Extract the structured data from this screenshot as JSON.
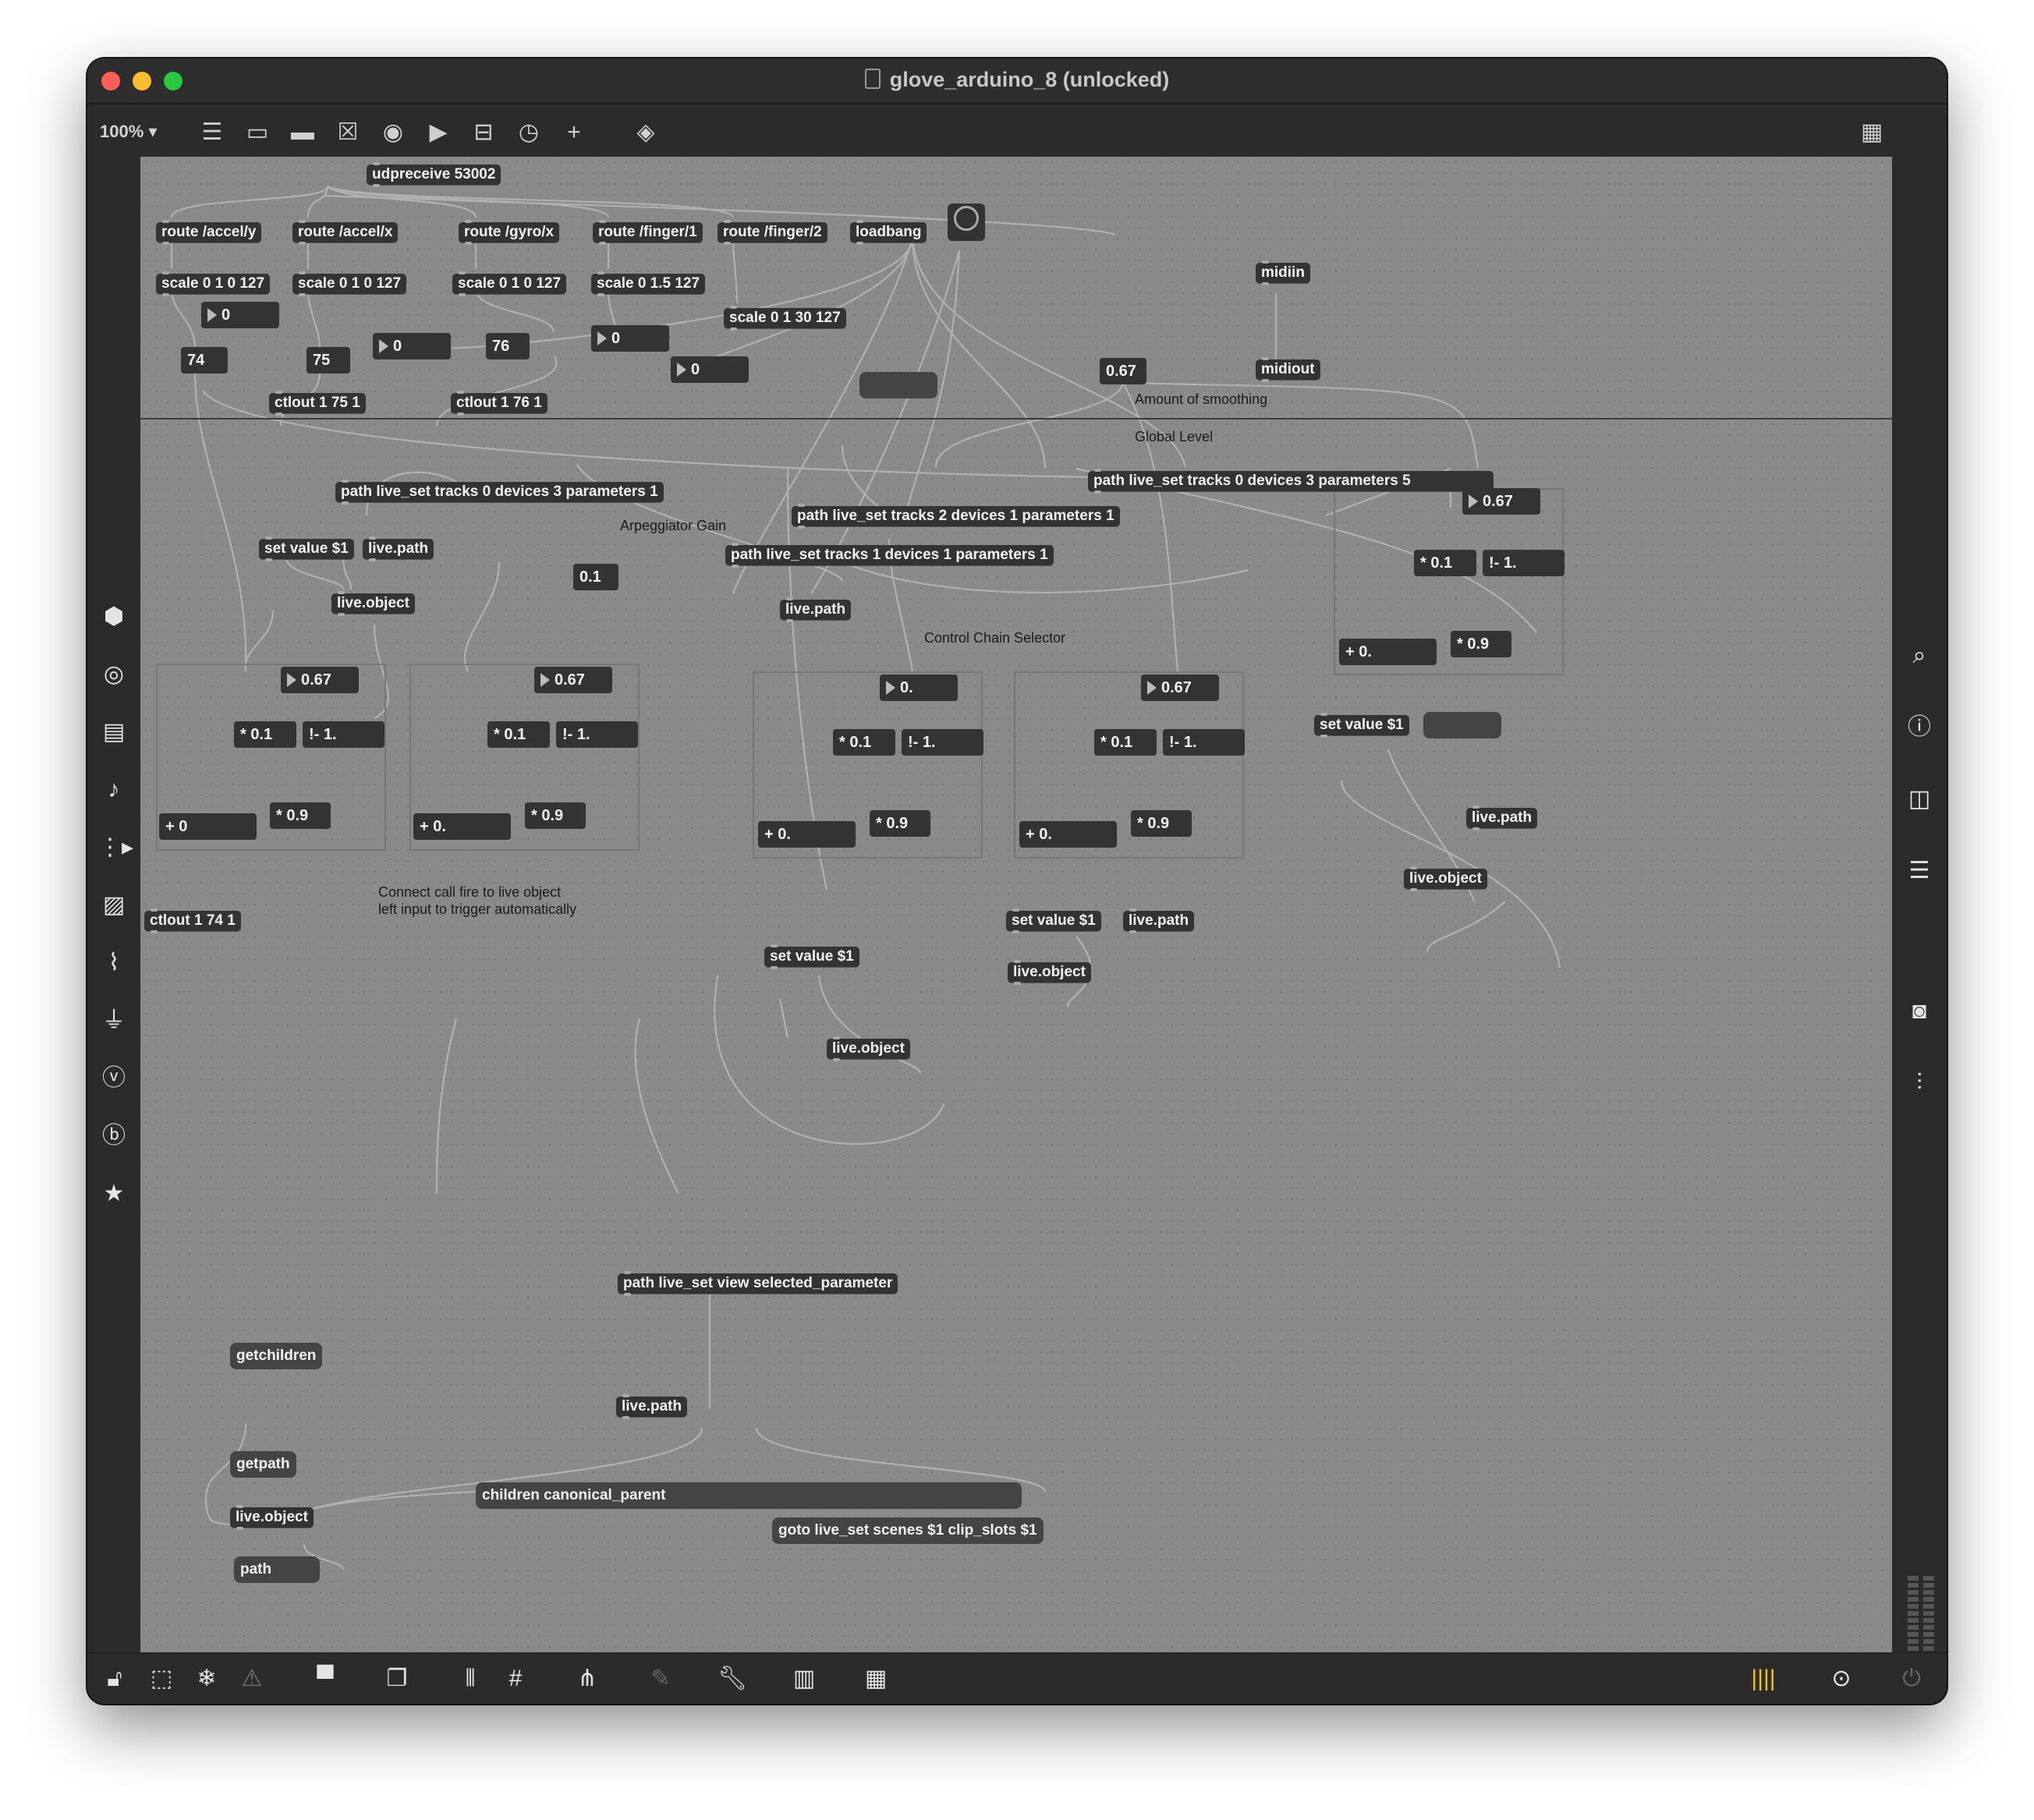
{
  "window": {
    "title": "glove_arduino_8 (unlocked)",
    "zoom": "100% ▾"
  },
  "colors": {
    "canvas": "#8a8a8a",
    "object": "#333333",
    "chrome": "#2b2b2b",
    "accent_yellow": "#f0c419"
  },
  "toolbar_icons": [
    "new-object-icon",
    "message-icon",
    "comment-icon",
    "toggle-icon",
    "button-icon",
    "number-icon",
    "slider-icon",
    "dial-icon",
    "add-icon",
    "paint-bucket-icon",
    "grid-icon"
  ],
  "objects": {
    "udpreceive": "udpreceive 53002",
    "route_accel_y": "route /accel/y",
    "route_accel_x": "route /accel/x",
    "route_gyro_x": "route /gyro/x",
    "route_finger1": "route /finger/1",
    "route_finger2": "route /finger/2",
    "loadbang": "loadbang",
    "scale1": "scale 0 1 0 127",
    "scale2": "scale 0 1 0 127",
    "scale3": "scale 0 1 0 127",
    "scale4": "scale 0 1.5 127",
    "scale5": "scale 0 1 30 127",
    "midiin": "midiin",
    "midiout": "midiout",
    "ctlout_75": "ctlout 1 75 1",
    "ctlout_76": "ctlout 1 76 1",
    "ctlout_74": "ctlout 1 74 1",
    "path_t0_d3_p1": "path live_set tracks 0 devices 3 parameters 1",
    "path_t0_d3_p5": "path live_set tracks 0 devices 3 parameters 5",
    "path_t2_d1_p1": "path live_set tracks 2 devices 1 parameters 1",
    "path_t1_d1_p1": "path live_set tracks 1 devices 1 parameters 1",
    "set_value_a": "set value $1",
    "set_value_b": "set value $1",
    "set_value_c": "set value $1",
    "set_value_d": "set value $1",
    "live_path_a": "live.path",
    "live_path_b": "live.path",
    "live_path_c": "live.path",
    "live_path_d": "live.path",
    "live_path_e": "live.path",
    "live_object_a": "live.object",
    "live_object_b": "live.object",
    "live_object_c": "live.object",
    "live_object_d": "live.object",
    "live_object_e": "live.object",
    "mul01": "* 0.1",
    "sub1": "!- 1.",
    "mul09": "* 0.9",
    "add0": "+ 0",
    "add0dot": "+ 0.",
    "path_selected": "path live_set view selected_parameter",
    "getchildren": "getchildren",
    "getpath": "getpath",
    "path_msg": "path",
    "children_msg": "children canonical_parent",
    "goto_msg": "goto live_set scenes $1 clip_slots $1"
  },
  "numbers": {
    "n0a": "0",
    "n74": "74",
    "n75": "75",
    "n0b": "0",
    "n76": "76",
    "n0c": "0",
    "n0d": "0",
    "n067_smooth": "0.67",
    "n067_right": "0.67",
    "n01": "0.1",
    "n067_p1": "0.67",
    "n067_p2": "0.67",
    "n0_p3": "0.",
    "n067_p4": "0.67"
  },
  "comments": {
    "smoothing": "Amount of smoothing",
    "global_level": "Global Level",
    "arp_gain": "Arpeggiator Gain",
    "control_chain": "Control Chain Selector",
    "connect_line1": "Connect call fire to live object",
    "connect_line2": "left input to trigger automatically"
  },
  "left_sidebar_icons": [
    "package-icon",
    "target-icon",
    "media-icon",
    "music-note-icon",
    "playlist-icon",
    "image-icon",
    "paperclip-icon",
    "plug-icon",
    "vimeo-icon",
    "bold-b-icon",
    "star-icon"
  ],
  "right_sidebar_icons": [
    "search-icon",
    "info-icon",
    "split-view-icon",
    "list-icon",
    "camera-icon",
    "mixer-icon"
  ],
  "bottom_icons": [
    "lock-icon",
    "select-icon",
    "freeze-icon",
    "warning-icon",
    "presentation-icon",
    "layers-icon",
    "align-icon",
    "grid-icon",
    "tree-icon",
    "pin-icon",
    "wrench-icon",
    "piano-icon",
    "keyboard-icon",
    "bars-icon",
    "play-circle-icon",
    "power-icon"
  ]
}
